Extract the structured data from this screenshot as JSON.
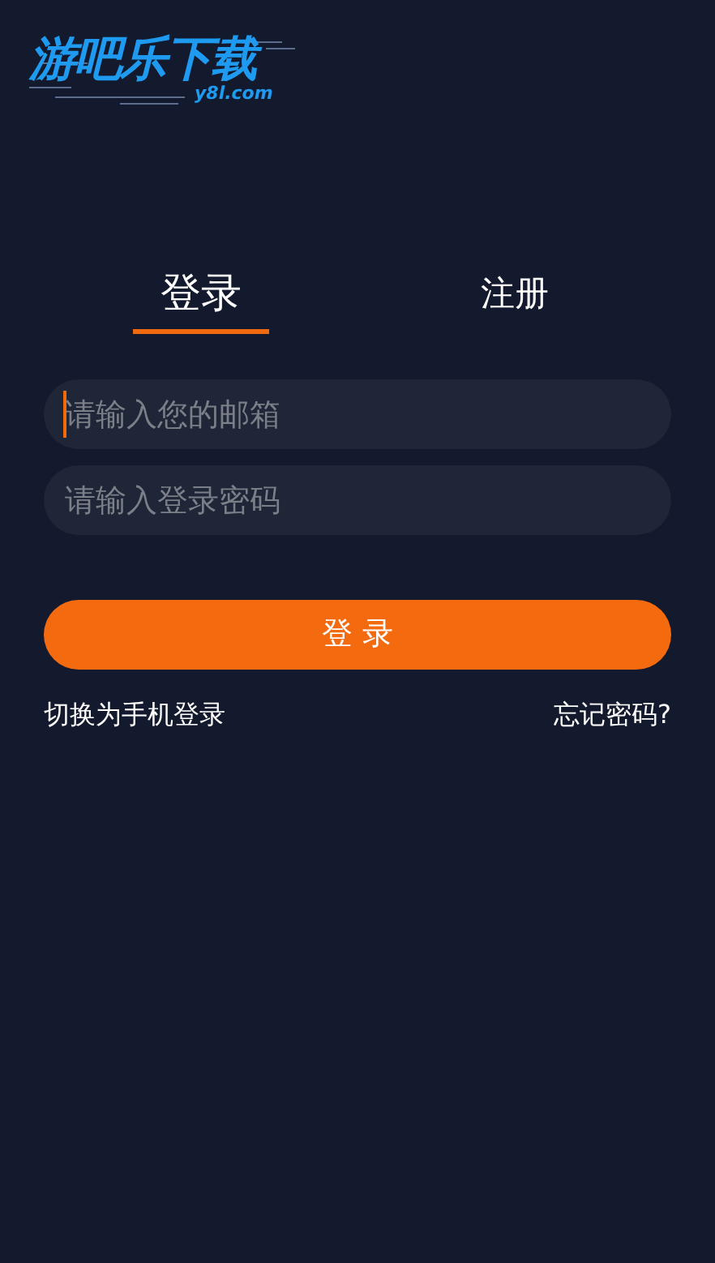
{
  "logo": {
    "title": "游吧乐下载",
    "domain": "y8l.com"
  },
  "tabs": [
    {
      "label": "登录",
      "selected": true
    },
    {
      "label": "注册",
      "selected": false
    }
  ],
  "fields": [
    {
      "placeholder": "请输入您的邮箱",
      "focused": true
    },
    {
      "placeholder": "请输入登录密码",
      "focused": false
    }
  ],
  "submit_button": "登 录",
  "links": {
    "switch": "切换为手机登录",
    "forgot": "忘记密码?"
  }
}
